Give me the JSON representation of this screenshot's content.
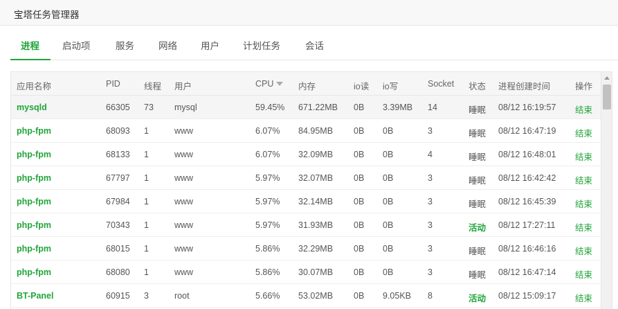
{
  "window": {
    "title": "宝塔任务管理器"
  },
  "tabs": [
    {
      "label": "进程",
      "active": true
    },
    {
      "label": "启动项",
      "active": false
    },
    {
      "label": "服务",
      "active": false
    },
    {
      "label": "网络",
      "active": false
    },
    {
      "label": "用户",
      "active": false
    },
    {
      "label": "计划任务",
      "active": false
    },
    {
      "label": "会话",
      "active": false
    }
  ],
  "table": {
    "columns": {
      "name": "应用名称",
      "pid": "PID",
      "threads": "线程",
      "user": "用户",
      "cpu": "CPU",
      "memory": "内存",
      "io_read": "io读",
      "io_write": "io写",
      "socket": "Socket",
      "status": "状态",
      "created": "进程创建时间",
      "action": "操作"
    },
    "sort": {
      "column": "cpu",
      "direction": "desc"
    },
    "rows": [
      {
        "name": "mysqld",
        "pid": "66305",
        "threads": "73",
        "user": "mysql",
        "cpu": "59.45%",
        "memory": "671.22MB",
        "io_read": "0B",
        "io_write": "3.39MB",
        "socket": "14",
        "status": "睡眠",
        "created": "08/12 16:19:57",
        "action": "结束"
      },
      {
        "name": "php-fpm",
        "pid": "68093",
        "threads": "1",
        "user": "www",
        "cpu": "6.07%",
        "memory": "84.95MB",
        "io_read": "0B",
        "io_write": "0B",
        "socket": "3",
        "status": "睡眠",
        "created": "08/12 16:47:19",
        "action": "结束"
      },
      {
        "name": "php-fpm",
        "pid": "68133",
        "threads": "1",
        "user": "www",
        "cpu": "6.07%",
        "memory": "32.09MB",
        "io_read": "0B",
        "io_write": "0B",
        "socket": "4",
        "status": "睡眠",
        "created": "08/12 16:48:01",
        "action": "结束"
      },
      {
        "name": "php-fpm",
        "pid": "67797",
        "threads": "1",
        "user": "www",
        "cpu": "5.97%",
        "memory": "32.07MB",
        "io_read": "0B",
        "io_write": "0B",
        "socket": "3",
        "status": "睡眠",
        "created": "08/12 16:42:42",
        "action": "结束"
      },
      {
        "name": "php-fpm",
        "pid": "67984",
        "threads": "1",
        "user": "www",
        "cpu": "5.97%",
        "memory": "32.14MB",
        "io_read": "0B",
        "io_write": "0B",
        "socket": "3",
        "status": "睡眠",
        "created": "08/12 16:45:39",
        "action": "结束"
      },
      {
        "name": "php-fpm",
        "pid": "70343",
        "threads": "1",
        "user": "www",
        "cpu": "5.97%",
        "memory": "31.93MB",
        "io_read": "0B",
        "io_write": "0B",
        "socket": "3",
        "status": "活动",
        "created": "08/12 17:27:11",
        "action": "结束"
      },
      {
        "name": "php-fpm",
        "pid": "68015",
        "threads": "1",
        "user": "www",
        "cpu": "5.86%",
        "memory": "32.29MB",
        "io_read": "0B",
        "io_write": "0B",
        "socket": "3",
        "status": "睡眠",
        "created": "08/12 16:46:16",
        "action": "结束"
      },
      {
        "name": "php-fpm",
        "pid": "68080",
        "threads": "1",
        "user": "www",
        "cpu": "5.86%",
        "memory": "30.07MB",
        "io_read": "0B",
        "io_write": "0B",
        "socket": "3",
        "status": "睡眠",
        "created": "08/12 16:47:14",
        "action": "结束"
      },
      {
        "name": "BT-Panel",
        "pid": "60915",
        "threads": "3",
        "user": "root",
        "cpu": "5.66%",
        "memory": "53.02MB",
        "io_read": "0B",
        "io_write": "9.05KB",
        "socket": "8",
        "status": "活动",
        "created": "08/12 15:09:17",
        "action": "结束"
      }
    ]
  },
  "colors": {
    "accent": "#20a53a",
    "header_bg": "#f6f6f6",
    "border": "#e6e6e6"
  }
}
